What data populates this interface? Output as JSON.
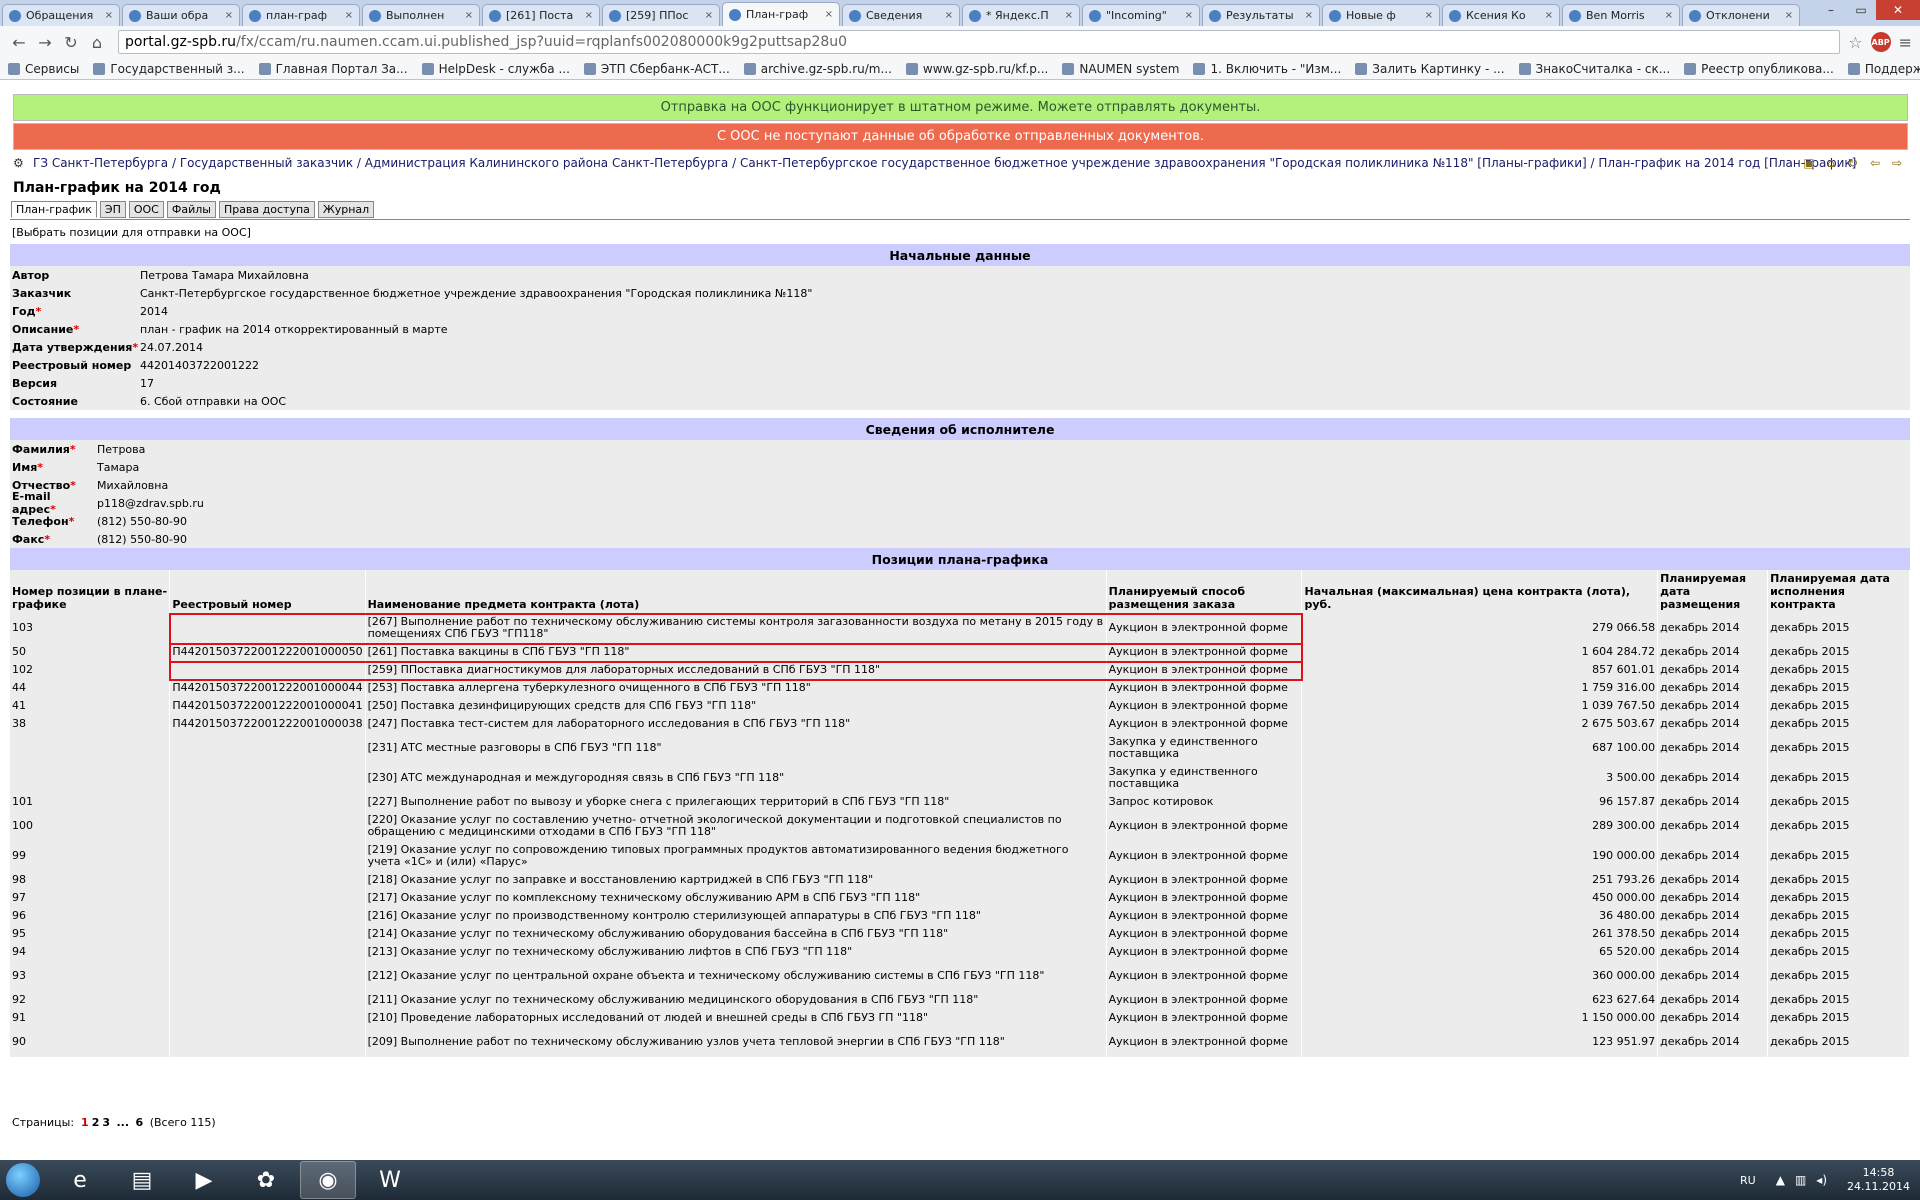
{
  "browser": {
    "tabs": [
      {
        "title": "Обращения"
      },
      {
        "title": "Ваши обра"
      },
      {
        "title": "план-граф"
      },
      {
        "title": "Выполнен"
      },
      {
        "title": "[261] Поста"
      },
      {
        "title": "[259] ППос"
      },
      {
        "title": "План-граф",
        "active": true
      },
      {
        "title": "Сведения"
      },
      {
        "title": "* Яндекс.П"
      },
      {
        "title": "\"Incoming\""
      },
      {
        "title": "Результаты"
      },
      {
        "title": "Новые ф"
      },
      {
        "title": "Ксения Ко"
      },
      {
        "title": "Ben Morris"
      },
      {
        "title": "Отклонени"
      }
    ],
    "url_host": "portal.gz-spb.ru",
    "url_path": "/fx/ccam/ru.naumen.ccam.ui.published_jsp?uuid=rqplanfs002080000k9g2puttsap28u0",
    "bookmarks": [
      "Сервисы",
      "Государственный з...",
      "Главная Портал За...",
      "HelpDesk - служба ...",
      "ЭТП Сбербанк-АСТ...",
      "archive.gz-spb.ru/m...",
      "www.gz-spb.ru/kf.p...",
      "NAUMEN system",
      "1. Включить - \"Изм...",
      "Залить Картинку - ...",
      "ЗнакоСчиталка - ск...",
      "Реестр опубликова...",
      "Поддержка проект..."
    ]
  },
  "banners": {
    "ok": "Отправка на ООС функционирует в штатном режиме. Можете отправлять документы.",
    "error": "С ООС не поступают данные об обработке отправленных документов."
  },
  "breadcrumb": "ГЗ Санкт-Петербурга / Государственный заказчик / Администрация Калининского района Санкт-Петербурга / Санкт-Петербургское государственное бюджетное учреждение здравоохранения \"Городская поликлиника №118\" [Планы-графики] / План-график на 2014 год [План-график]",
  "page_title": "План-график на 2014 год",
  "tabs": [
    "План-график",
    "ЭП",
    "ООС",
    "Файлы",
    "Права доступа",
    "Журнал"
  ],
  "send_link": "[Выбрать позиции для отправки на ООС]",
  "section_initial": {
    "title": "Начальные данные",
    "rows": [
      {
        "label": "Автор",
        "required": false,
        "value": "Петрова Тамара Михайловна"
      },
      {
        "label": "Заказчик",
        "required": false,
        "value": "Санкт-Петербургское государственное бюджетное учреждение здравоохранения \"Городская поликлиника №118\""
      },
      {
        "label": "Год",
        "required": true,
        "value": "2014"
      },
      {
        "label": "Описание",
        "required": true,
        "value": "план - график на 2014 откорректированный в марте"
      },
      {
        "label": "Дата утверждения",
        "required": true,
        "value": "24.07.2014"
      },
      {
        "label": "Реестровый номер",
        "required": false,
        "value": "44201403722001222"
      },
      {
        "label": "Версия",
        "required": false,
        "value": "17"
      },
      {
        "label": "Состояние",
        "required": false,
        "value": "6. Сбой отправки на ООС"
      }
    ]
  },
  "section_executor": {
    "title": "Сведения об исполнителе",
    "rows": [
      {
        "label": "Фамилия",
        "required": true,
        "value": "Петрова"
      },
      {
        "label": "Имя",
        "required": true,
        "value": "Тамара"
      },
      {
        "label": "Отчество",
        "required": true,
        "value": "Михайловна"
      },
      {
        "label": "E-mail адрес",
        "required": true,
        "value": "p118@zdrav.spb.ru"
      },
      {
        "label": "Телефон",
        "required": true,
        "value": "(812) 550-80-90"
      },
      {
        "label": "Факс",
        "required": true,
        "value": "(812) 550-80-90"
      }
    ]
  },
  "section_positions": {
    "title": "Позиции плана-графика",
    "columns": [
      "Номер позиции в плане-графике",
      "Реестровый номер",
      "Наименование предмета контракта (лота)",
      "Планируемый способ размещения заказа",
      "Начальная (максимальная) цена контракта (лота), руб.",
      "Планируемая дата размещения",
      "Планируемая дата исполнения контракта"
    ],
    "rows": [
      [
        "103",
        "",
        "[267] Выполнение работ по техническому обслуживанию системы контроля загазованности воздуха по метану в 2015 году в помещениях СПб ГБУЗ \"ГП118\"",
        "Аукцион в электронной форме",
        "279 066.58",
        "декабрь 2014",
        "декабрь 2015"
      ],
      [
        "50",
        "П44201503722001222001000050",
        "[261] Поставка вакцины в СПб ГБУЗ \"ГП 118\"",
        "Аукцион в электронной форме",
        "1 604 284.72",
        "декабрь 2014",
        "декабрь 2015"
      ],
      [
        "102",
        "",
        "[259] ППоставка диагностикумов для лабораторных исследований в СПб ГБУЗ \"ГП 118\"",
        "Аукцион в электронной форме",
        "857 601.01",
        "декабрь 2014",
        "декабрь 2015"
      ],
      [
        "44",
        "П44201503722001222001000044",
        "[253] Поставка аллергена туберкулезного очищенного в СПб ГБУЗ \"ГП 118\"",
        "Аукцион в электронной форме",
        "1 759 316.00",
        "декабрь 2014",
        "декабрь 2015"
      ],
      [
        "41",
        "П44201503722001222001000041",
        "[250] Поставка дезинфицирующих средств для СПб ГБУЗ \"ГП 118\"",
        "Аукцион в электронной форме",
        "1 039 767.50",
        "декабрь 2014",
        "декабрь 2015"
      ],
      [
        "38",
        "П44201503722001222001000038",
        "[247] Поставка тест-систем для лабораторного исследования в СПб ГБУЗ \"ГП 118\"",
        "Аукцион в электронной форме",
        "2 675 503.67",
        "декабрь 2014",
        "декабрь 2015"
      ],
      [
        "",
        "",
        "[231] АТС местные разговоры в СПб ГБУЗ \"ГП 118\"",
        "Закупка у единственного поставщика",
        "687 100.00",
        "декабрь 2014",
        "декабрь 2015"
      ],
      [
        "",
        "",
        "[230] АТС международная и междугородняя связь в СПб ГБУЗ \"ГП 118\"",
        "Закупка у единственного поставщика",
        "3 500.00",
        "декабрь 2014",
        "декабрь 2015"
      ],
      [
        "101",
        "",
        "[227] Выполнение работ по вывозу и уборке снега с прилегающих территорий в СПб ГБУЗ \"ГП 118\"",
        "Запрос котировок",
        "96 157.87",
        "декабрь 2014",
        "декабрь 2015"
      ],
      [
        "100",
        "",
        "[220] Оказание услуг по составлению учетно- отчетной экологической документации и подготовкой специалистов по обращению с медицинскими отходами в СПб ГБУЗ \"ГП 118\"",
        "Аукцион в электронной форме",
        "289 300.00",
        "декабрь 2014",
        "декабрь 2015"
      ],
      [
        "99",
        "",
        "[219] Оказание услуг по сопровождению типовых программных продуктов автоматизированного ведения бюджетного учета «1С» и (или) «Парус»",
        "Аукцион в электронной форме",
        "190 000.00",
        "декабрь 2014",
        "декабрь 2015"
      ],
      [
        "98",
        "",
        "[218] Оказание услуг по заправке и восстановлению картриджей в СПб ГБУЗ \"ГП 118\"",
        "Аукцион в электронной форме",
        "251 793.26",
        "декабрь 2014",
        "декабрь 2015"
      ],
      [
        "97",
        "",
        "[217] Оказание услуг по комплексному техническому обслуживанию АРМ в СПб ГБУЗ \"ГП 118\"",
        "Аукцион в электронной форме",
        "450 000.00",
        "декабрь 2014",
        "декабрь 2015"
      ],
      [
        "96",
        "",
        "[216] Оказание услуг по производственному контролю стерилизующей аппаратуры в СПб ГБУЗ \"ГП 118\"",
        "Аукцион в электронной форме",
        "36 480.00",
        "декабрь 2014",
        "декабрь 2015"
      ],
      [
        "95",
        "",
        "[214] Оказание услуг по техническому обслуживанию оборудования бассейна в СПб ГБУЗ \"ГП 118\"",
        "Аукцион в электронной форме",
        "261 378.50",
        "декабрь 2014",
        "декабрь 2015"
      ],
      [
        "94",
        "",
        "[213] Оказание услуг по техническому обслуживанию лифтов в СПб ГБУЗ \"ГП 118\"",
        "Аукцион в электронной форме",
        "65 520.00",
        "декабрь 2014",
        "декабрь 2015"
      ],
      [
        "93",
        "",
        "[212] Оказание услуг по центральной охране объекта и техническому обслуживанию системы в СПб ГБУЗ \"ГП 118\"",
        "Аукцион в электронной форме",
        "360 000.00",
        "декабрь 2014",
        "декабрь 2015"
      ],
      [
        "92",
        "",
        "[211] Оказание услуг по техническому обслуживанию медицинского оборудования в СПб ГБУЗ \"ГП 118\"",
        "Аукцион в электронной форме",
        "623 627.64",
        "декабрь 2014",
        "декабрь 2015"
      ],
      [
        "91",
        "",
        "[210] Проведение лабораторных исследований от людей и внешней среды в СПб ГБУЗ ГП \"118\"",
        "Аукцион в электронной форме",
        "1 150 000.00",
        "декабрь 2014",
        "декабрь 2015"
      ],
      [
        "90",
        "",
        "[209] Выполнение работ по техническому обслуживанию узлов учета тепловой энергии в СПб ГБУЗ \"ГП 118\"",
        "Аукцион в электронной форме",
        "123 951.97",
        "декабрь 2014",
        "декабрь 2015"
      ]
    ]
  },
  "pager": {
    "label": "Страницы:",
    "pages": [
      "1",
      "2",
      "3"
    ],
    "ellipsis": "...",
    "last": "6",
    "total": "(Всего 115)"
  },
  "taskbar": {
    "lang": "RU",
    "time": "14:58",
    "date": "24.11.2014"
  },
  "colors": {
    "banner_ok": "#b4f07c",
    "banner_error": "#ee6a4f",
    "section_header": "#ccccff",
    "highlight": "#e0101f"
  }
}
